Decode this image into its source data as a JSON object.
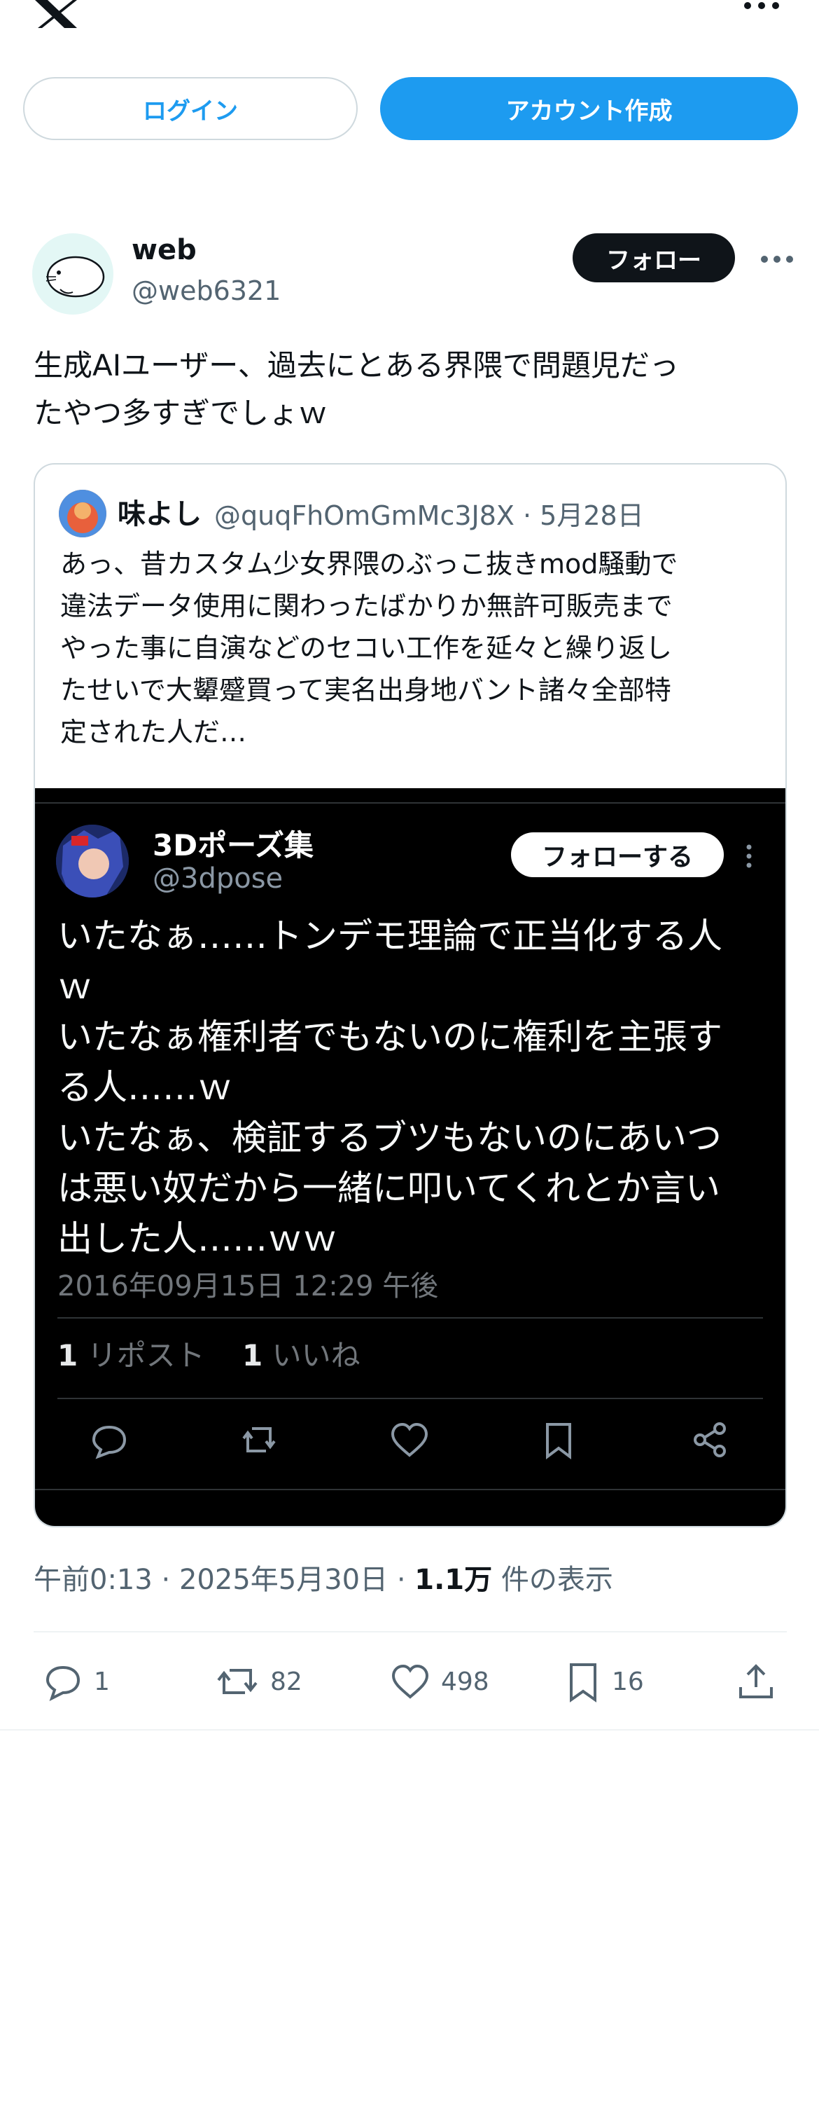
{
  "header": {
    "logo_icon": "x-logo-icon",
    "more_icon": "more-icon"
  },
  "auth": {
    "login_label": "ログイン",
    "signup_label": "アカウント作成"
  },
  "post": {
    "author_name": "web",
    "author_handle": "@web6321",
    "follow_label": "フォロー",
    "text": "生成AIユーザー、過去にとある界隈で問題児だっ\nたやつ多すぎでしょｗ",
    "quote": {
      "author_name": "味よし",
      "author_handle": "@quqFhOmGmMc3J8X · 5月28日",
      "text": "あっ、昔カスタム少女界隈のぶっこ抜きmod騒動で\n違法データ使用に関わったばかりか無許可販売まで\nやった事に自演などのセコい工作を延々と繰り返し\nたせいで大顰蹙買って実名出身地バント諸々全部特\n定された人だ…",
      "embedded": {
        "author_name": "3Dポーズ集",
        "author_handle": "@3dpose",
        "follow_label": "フォローする",
        "text": "いたなぁ……トンデモ理論で正当化する人\nｗ\nいたなぁ権利者でもないのに権利を主張す\nる人……ｗ\nいたなぁ、検証するブツもないのにあいつ\nは悪い奴だから一緒に叩いてくれとか言い\n出した人……ｗｗ",
        "timestamp": "2016年09月15日 12:29 午後",
        "repost_count": "1",
        "repost_label": "リポスト",
        "like_count": "1",
        "like_label": "いいね"
      }
    },
    "meta": {
      "time": "午前0:13 · 2025年5月30日 · ",
      "views_count": "1.1万",
      "views_label": " 件の表示"
    },
    "actions": {
      "reply_count": "1",
      "repost_count": "82",
      "like_count": "498",
      "bookmark_count": "16"
    }
  },
  "colors": {
    "accent": "#1d9bf0",
    "text": "#0f1419",
    "muted": "#536471",
    "border": "#cfd9de"
  }
}
